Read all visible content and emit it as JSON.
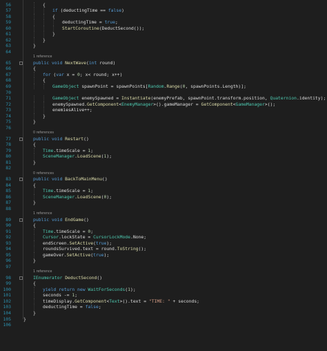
{
  "theme": {
    "background": "#1e1e1e",
    "line_number": "#2b91af",
    "reference_hint": "#999999",
    "colors": {
      "kw": "#569cd6",
      "ty": "#4ec9b0",
      "mt": "#dcdcaa",
      "st": "#d69d85",
      "nm": "#b5cea8",
      "pm": "#9cdcfe",
      "pl": "#dcdcdc"
    }
  },
  "editor": {
    "language": "C#",
    "rows": [
      {
        "type": "code",
        "num": "56",
        "indent": 2,
        "tokens": [
          [
            "pl",
            "{"
          ]
        ]
      },
      {
        "type": "code",
        "num": "57",
        "indent": 3,
        "tokens": [
          [
            "kw",
            "if"
          ],
          [
            "pl",
            " (deductingTime == "
          ],
          [
            "kw",
            "false"
          ],
          [
            "pl",
            ")"
          ]
        ]
      },
      {
        "type": "code",
        "num": "58",
        "indent": 3,
        "tokens": [
          [
            "pl",
            "{"
          ]
        ]
      },
      {
        "type": "code",
        "num": "59",
        "indent": 4,
        "tokens": [
          [
            "pl",
            "deductingTime = "
          ],
          [
            "kw",
            "true"
          ],
          [
            "pl",
            ";"
          ]
        ]
      },
      {
        "type": "code",
        "num": "60",
        "indent": 4,
        "tokens": [
          [
            "mt",
            "StartCoroutine"
          ],
          [
            "pl",
            "(DeductSecond());"
          ]
        ]
      },
      {
        "type": "code",
        "num": "61",
        "indent": 3,
        "tokens": [
          [
            "pl",
            "}"
          ]
        ]
      },
      {
        "type": "code",
        "num": "62",
        "indent": 2,
        "tokens": [
          [
            "pl",
            "}"
          ]
        ]
      },
      {
        "type": "code",
        "num": "63",
        "indent": 1,
        "tokens": [
          [
            "pl",
            "}"
          ]
        ]
      },
      {
        "type": "code",
        "num": "64",
        "indent": 0,
        "tokens": []
      },
      {
        "type": "ref",
        "text": "1 reference",
        "indent": 1
      },
      {
        "type": "code",
        "num": "65",
        "indent": 1,
        "tokens": [
          [
            "kw",
            "public void "
          ],
          [
            "mt",
            "NextWave"
          ],
          [
            "pl",
            "("
          ],
          [
            "kw",
            "int"
          ],
          [
            "pl",
            " round)"
          ]
        ]
      },
      {
        "type": "code",
        "num": "66",
        "indent": 1,
        "tokens": [
          [
            "pl",
            "{"
          ]
        ]
      },
      {
        "type": "code",
        "num": "67",
        "indent": 2,
        "tokens": [
          [
            "kw",
            "for"
          ],
          [
            "pl",
            " ("
          ],
          [
            "kw",
            "var"
          ],
          [
            "pl",
            " x = "
          ],
          [
            "nm",
            "0"
          ],
          [
            "pl",
            "; x< round; x++)"
          ]
        ]
      },
      {
        "type": "code",
        "num": "68",
        "indent": 2,
        "tokens": [
          [
            "pl",
            "{"
          ]
        ]
      },
      {
        "type": "code",
        "num": "69",
        "indent": 3,
        "tokens": [
          [
            "ty",
            "GameObject"
          ],
          [
            "pl",
            " spawnPoint = spawnPoints["
          ],
          [
            "ty",
            "Random"
          ],
          [
            "pl",
            "."
          ],
          [
            "mt",
            "Range"
          ],
          [
            "pl",
            "("
          ],
          [
            "nm",
            "0"
          ],
          [
            "pl",
            ", spawnPoints.Length)];"
          ]
        ]
      },
      {
        "type": "code",
        "num": "70",
        "indent": 0,
        "tokens": []
      },
      {
        "type": "code",
        "num": "71",
        "indent": 3,
        "tokens": [
          [
            "ty",
            "GameObject"
          ],
          [
            "pl",
            " enemySpawned = "
          ],
          [
            "mt",
            "Instantiate"
          ],
          [
            "pl",
            "(enemyPrefab, spawnPoint.transform.position, "
          ],
          [
            "ty",
            "Quaternion"
          ],
          [
            "pl",
            ".identity);"
          ]
        ]
      },
      {
        "type": "code",
        "num": "72",
        "indent": 3,
        "tokens": [
          [
            "pl",
            "enemySpawned."
          ],
          [
            "mt",
            "GetComponent"
          ],
          [
            "pl",
            "<"
          ],
          [
            "ty",
            "EnemyManager"
          ],
          [
            "pl",
            ">().gameManager = "
          ],
          [
            "mt",
            "GetComponent"
          ],
          [
            "pl",
            "<"
          ],
          [
            "ty",
            "GameManager"
          ],
          [
            "pl",
            ">();"
          ]
        ]
      },
      {
        "type": "code",
        "num": "73",
        "indent": 3,
        "tokens": [
          [
            "pl",
            "enemiesAlive++;"
          ]
        ]
      },
      {
        "type": "code",
        "num": "74",
        "indent": 2,
        "tokens": [
          [
            "pl",
            "}"
          ]
        ]
      },
      {
        "type": "code",
        "num": "75",
        "indent": 1,
        "tokens": [
          [
            "pl",
            "}"
          ]
        ]
      },
      {
        "type": "code",
        "num": "76",
        "indent": 0,
        "tokens": []
      },
      {
        "type": "ref",
        "text": "0 references",
        "indent": 1
      },
      {
        "type": "code",
        "num": "77",
        "indent": 1,
        "tokens": [
          [
            "kw",
            "public void "
          ],
          [
            "mt",
            "Restart"
          ],
          [
            "pl",
            "()"
          ]
        ]
      },
      {
        "type": "code",
        "num": "78",
        "indent": 1,
        "tokens": [
          [
            "pl",
            "{"
          ]
        ]
      },
      {
        "type": "code",
        "num": "79",
        "indent": 2,
        "tokens": [
          [
            "ty",
            "Time"
          ],
          [
            "pl",
            ".timeScale = "
          ],
          [
            "nm",
            "1"
          ],
          [
            "pl",
            ";"
          ]
        ]
      },
      {
        "type": "code",
        "num": "80",
        "indent": 2,
        "tokens": [
          [
            "ty",
            "SceneManager"
          ],
          [
            "pl",
            "."
          ],
          [
            "mt",
            "LoadScene"
          ],
          [
            "pl",
            "("
          ],
          [
            "nm",
            "1"
          ],
          [
            "pl",
            ");"
          ]
        ]
      },
      {
        "type": "code",
        "num": "81",
        "indent": 1,
        "tokens": [
          [
            "pl",
            "}"
          ]
        ]
      },
      {
        "type": "code",
        "num": "82",
        "indent": 0,
        "tokens": []
      },
      {
        "type": "ref",
        "text": "0 references",
        "indent": 1
      },
      {
        "type": "code",
        "num": "83",
        "indent": 1,
        "tokens": [
          [
            "kw",
            "public void "
          ],
          [
            "mt",
            "BackToMainMenu"
          ],
          [
            "pl",
            "()"
          ]
        ]
      },
      {
        "type": "code",
        "num": "84",
        "indent": 1,
        "tokens": [
          [
            "pl",
            "{"
          ]
        ]
      },
      {
        "type": "code",
        "num": "85",
        "indent": 2,
        "tokens": [
          [
            "ty",
            "Time"
          ],
          [
            "pl",
            ".timeScale = "
          ],
          [
            "nm",
            "1"
          ],
          [
            "pl",
            ";"
          ]
        ]
      },
      {
        "type": "code",
        "num": "86",
        "indent": 2,
        "tokens": [
          [
            "ty",
            "SceneManager"
          ],
          [
            "pl",
            "."
          ],
          [
            "mt",
            "LoadScene"
          ],
          [
            "pl",
            "("
          ],
          [
            "nm",
            "0"
          ],
          [
            "pl",
            ");"
          ]
        ]
      },
      {
        "type": "code",
        "num": "87",
        "indent": 1,
        "tokens": [
          [
            "pl",
            "}"
          ]
        ]
      },
      {
        "type": "code",
        "num": "88",
        "indent": 0,
        "tokens": []
      },
      {
        "type": "ref",
        "text": "1 reference",
        "indent": 1
      },
      {
        "type": "code",
        "num": "89",
        "indent": 1,
        "tokens": [
          [
            "kw",
            "public void "
          ],
          [
            "mt",
            "EndGame"
          ],
          [
            "pl",
            "()"
          ]
        ]
      },
      {
        "type": "code",
        "num": "90",
        "indent": 1,
        "tokens": [
          [
            "pl",
            "{"
          ]
        ]
      },
      {
        "type": "code",
        "num": "91",
        "indent": 2,
        "tokens": [
          [
            "ty",
            "Time"
          ],
          [
            "pl",
            ".timeScale = "
          ],
          [
            "nm",
            "0"
          ],
          [
            "pl",
            ";"
          ]
        ]
      },
      {
        "type": "code",
        "num": "92",
        "indent": 2,
        "tokens": [
          [
            "ty",
            "Cursor"
          ],
          [
            "pl",
            ".lockState = "
          ],
          [
            "ty",
            "CursorLockMode"
          ],
          [
            "pl",
            ".None;"
          ]
        ]
      },
      {
        "type": "code",
        "num": "93",
        "indent": 2,
        "tokens": [
          [
            "pl",
            "endScreen."
          ],
          [
            "mt",
            "SetActive"
          ],
          [
            "pl",
            "("
          ],
          [
            "kw",
            "true"
          ],
          [
            "pl",
            ");"
          ]
        ]
      },
      {
        "type": "code",
        "num": "94",
        "indent": 2,
        "tokens": [
          [
            "pl",
            "roundsSurvived.text = round."
          ],
          [
            "mt",
            "ToString"
          ],
          [
            "pl",
            "();"
          ]
        ]
      },
      {
        "type": "code",
        "num": "95",
        "indent": 2,
        "tokens": [
          [
            "pl",
            "gameOver."
          ],
          [
            "mt",
            "SetActive"
          ],
          [
            "pl",
            "("
          ],
          [
            "kw",
            "true"
          ],
          [
            "pl",
            ");"
          ]
        ]
      },
      {
        "type": "code",
        "num": "96",
        "indent": 1,
        "tokens": [
          [
            "pl",
            "}"
          ]
        ]
      },
      {
        "type": "code",
        "num": "97",
        "indent": 0,
        "tokens": []
      },
      {
        "type": "ref",
        "text": "1 reference",
        "indent": 1
      },
      {
        "type": "code",
        "num": "98",
        "indent": 1,
        "tokens": [
          [
            "ty",
            "IEnumerator"
          ],
          [
            "pl",
            " "
          ],
          [
            "mt",
            "DeductSecond"
          ],
          [
            "pl",
            "()"
          ]
        ]
      },
      {
        "type": "code",
        "num": "99",
        "indent": 1,
        "tokens": [
          [
            "pl",
            "{"
          ]
        ]
      },
      {
        "type": "code",
        "num": "100",
        "indent": 2,
        "tokens": [
          [
            "kw",
            "yield return new "
          ],
          [
            "ty",
            "WaitForSeconds"
          ],
          [
            "pl",
            "("
          ],
          [
            "nm",
            "1"
          ],
          [
            "pl",
            ");"
          ]
        ]
      },
      {
        "type": "code",
        "num": "101",
        "indent": 2,
        "tokens": [
          [
            "pl",
            "seconds -= "
          ],
          [
            "nm",
            "1"
          ],
          [
            "pl",
            ";"
          ]
        ]
      },
      {
        "type": "code",
        "num": "102",
        "indent": 2,
        "tokens": [
          [
            "pl",
            "timeDisplay."
          ],
          [
            "mt",
            "GetComponent"
          ],
          [
            "pl",
            "<"
          ],
          [
            "ty",
            "Text"
          ],
          [
            "pl",
            ">().text = "
          ],
          [
            "st",
            "\"TIME: \""
          ],
          [
            "pl",
            " + seconds;"
          ]
        ]
      },
      {
        "type": "code",
        "num": "103",
        "indent": 2,
        "tokens": [
          [
            "pl",
            "deductingTime = "
          ],
          [
            "kw",
            "false"
          ],
          [
            "pl",
            ";"
          ]
        ]
      },
      {
        "type": "code",
        "num": "104",
        "indent": 1,
        "tokens": [
          [
            "pl",
            "}"
          ]
        ]
      },
      {
        "type": "code",
        "num": "105",
        "indent": 0,
        "tokens": [
          [
            "pl",
            "}"
          ]
        ]
      },
      {
        "type": "code",
        "num": "106",
        "indent": 0,
        "tokens": []
      }
    ]
  }
}
